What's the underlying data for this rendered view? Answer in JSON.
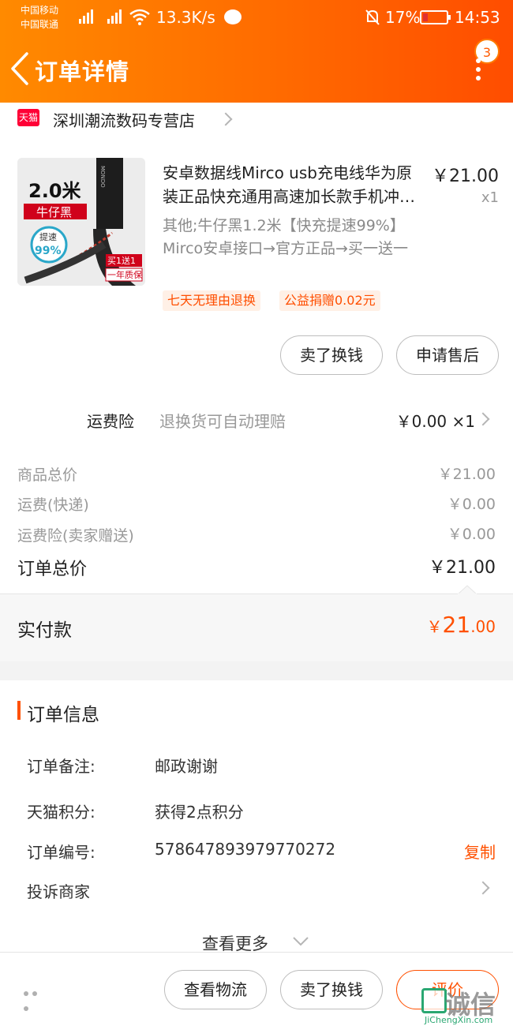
{
  "status_bar": {
    "carrier1": "中国移动",
    "carrier2": "中国联通",
    "net1": "2G",
    "net2": "4G",
    "speed": "13.3K/s",
    "battery": "17%",
    "time": "14:53"
  },
  "header": {
    "title": "订单详情",
    "badge_count": "3"
  },
  "store": {
    "badge": "天猫",
    "name": "深圳潮流数码专营店"
  },
  "product": {
    "image_text": {
      "size": "2.0米",
      "color": "牛仔黑",
      "speed_label": "提速",
      "speed_value": "99%",
      "promo1": "买1送1",
      "promo2": "一年质保",
      "brand": "MONDO"
    },
    "title": "安卓数据线Mirco usb充电线华为原装正品快充通用高速加长款手机冲电器",
    "price": "￥21.00",
    "qty": "x1",
    "spec": "其他;牛仔黑1.2米【快充提速99%】Mirco安卓接口→官方正品→买一送一",
    "tags": [
      "七天无理由退换",
      "公益捐赠0.02元"
    ],
    "actions": [
      "卖了换钱",
      "申请售后"
    ]
  },
  "insurance": {
    "label": "运费险",
    "desc": "退换货可自动理赔",
    "value": "￥0.00 ×1"
  },
  "price_summary": {
    "rows": [
      {
        "label": "商品总价",
        "value": "￥21.00"
      },
      {
        "label": "运费(快递)",
        "value": "￥0.00"
      },
      {
        "label": "运费险(卖家赠送)",
        "value": "￥0.00"
      }
    ],
    "total_label": "订单总价",
    "total_value": "￥21.00",
    "paid_label": "实付款",
    "paid_symbol": "￥",
    "paid_int": "21",
    "paid_dec": ".00"
  },
  "order_info": {
    "title": "订单信息",
    "remark_label": "订单备注:",
    "remark_value": "邮政谢谢",
    "points_label": "天猫积分:",
    "points_value": "获得2点积分",
    "order_no_label": "订单编号:",
    "order_no_value": "578647893979770272",
    "copy_label": "复制",
    "complain_label": "投诉商家",
    "see_more": "查看更多"
  },
  "bottom_bar": {
    "buttons": [
      "查看物流",
      "卖了换钱",
      "评价"
    ]
  },
  "watermark": {
    "text": "诚信",
    "url": "JiChengXin.com"
  },
  "colors": {
    "accent": "#ff5000",
    "header_start": "#ff8a00",
    "header_end": "#ff4d00",
    "tag_bg": "#fff0e6"
  }
}
